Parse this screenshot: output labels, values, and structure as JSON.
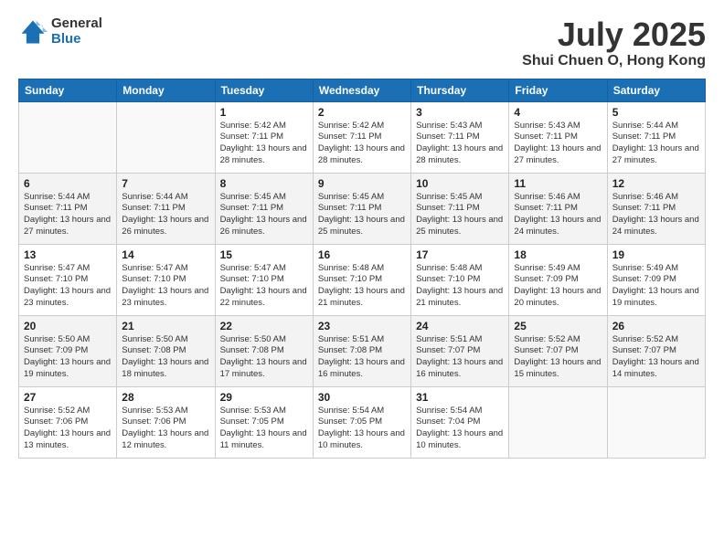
{
  "logo": {
    "general": "General",
    "blue": "Blue"
  },
  "title": "July 2025",
  "subtitle": "Shui Chuen O, Hong Kong",
  "headers": [
    "Sunday",
    "Monday",
    "Tuesday",
    "Wednesday",
    "Thursday",
    "Friday",
    "Saturday"
  ],
  "weeks": [
    [
      {
        "day": "",
        "sunrise": "",
        "sunset": "",
        "daylight": ""
      },
      {
        "day": "",
        "sunrise": "",
        "sunset": "",
        "daylight": ""
      },
      {
        "day": "1",
        "sunrise": "Sunrise: 5:42 AM",
        "sunset": "Sunset: 7:11 PM",
        "daylight": "Daylight: 13 hours and 28 minutes."
      },
      {
        "day": "2",
        "sunrise": "Sunrise: 5:42 AM",
        "sunset": "Sunset: 7:11 PM",
        "daylight": "Daylight: 13 hours and 28 minutes."
      },
      {
        "day": "3",
        "sunrise": "Sunrise: 5:43 AM",
        "sunset": "Sunset: 7:11 PM",
        "daylight": "Daylight: 13 hours and 28 minutes."
      },
      {
        "day": "4",
        "sunrise": "Sunrise: 5:43 AM",
        "sunset": "Sunset: 7:11 PM",
        "daylight": "Daylight: 13 hours and 27 minutes."
      },
      {
        "day": "5",
        "sunrise": "Sunrise: 5:44 AM",
        "sunset": "Sunset: 7:11 PM",
        "daylight": "Daylight: 13 hours and 27 minutes."
      }
    ],
    [
      {
        "day": "6",
        "sunrise": "Sunrise: 5:44 AM",
        "sunset": "Sunset: 7:11 PM",
        "daylight": "Daylight: 13 hours and 27 minutes."
      },
      {
        "day": "7",
        "sunrise": "Sunrise: 5:44 AM",
        "sunset": "Sunset: 7:11 PM",
        "daylight": "Daylight: 13 hours and 26 minutes."
      },
      {
        "day": "8",
        "sunrise": "Sunrise: 5:45 AM",
        "sunset": "Sunset: 7:11 PM",
        "daylight": "Daylight: 13 hours and 26 minutes."
      },
      {
        "day": "9",
        "sunrise": "Sunrise: 5:45 AM",
        "sunset": "Sunset: 7:11 PM",
        "daylight": "Daylight: 13 hours and 25 minutes."
      },
      {
        "day": "10",
        "sunrise": "Sunrise: 5:45 AM",
        "sunset": "Sunset: 7:11 PM",
        "daylight": "Daylight: 13 hours and 25 minutes."
      },
      {
        "day": "11",
        "sunrise": "Sunrise: 5:46 AM",
        "sunset": "Sunset: 7:11 PM",
        "daylight": "Daylight: 13 hours and 24 minutes."
      },
      {
        "day": "12",
        "sunrise": "Sunrise: 5:46 AM",
        "sunset": "Sunset: 7:11 PM",
        "daylight": "Daylight: 13 hours and 24 minutes."
      }
    ],
    [
      {
        "day": "13",
        "sunrise": "Sunrise: 5:47 AM",
        "sunset": "Sunset: 7:10 PM",
        "daylight": "Daylight: 13 hours and 23 minutes."
      },
      {
        "day": "14",
        "sunrise": "Sunrise: 5:47 AM",
        "sunset": "Sunset: 7:10 PM",
        "daylight": "Daylight: 13 hours and 23 minutes."
      },
      {
        "day": "15",
        "sunrise": "Sunrise: 5:47 AM",
        "sunset": "Sunset: 7:10 PM",
        "daylight": "Daylight: 13 hours and 22 minutes."
      },
      {
        "day": "16",
        "sunrise": "Sunrise: 5:48 AM",
        "sunset": "Sunset: 7:10 PM",
        "daylight": "Daylight: 13 hours and 21 minutes."
      },
      {
        "day": "17",
        "sunrise": "Sunrise: 5:48 AM",
        "sunset": "Sunset: 7:10 PM",
        "daylight": "Daylight: 13 hours and 21 minutes."
      },
      {
        "day": "18",
        "sunrise": "Sunrise: 5:49 AM",
        "sunset": "Sunset: 7:09 PM",
        "daylight": "Daylight: 13 hours and 20 minutes."
      },
      {
        "day": "19",
        "sunrise": "Sunrise: 5:49 AM",
        "sunset": "Sunset: 7:09 PM",
        "daylight": "Daylight: 13 hours and 19 minutes."
      }
    ],
    [
      {
        "day": "20",
        "sunrise": "Sunrise: 5:50 AM",
        "sunset": "Sunset: 7:09 PM",
        "daylight": "Daylight: 13 hours and 19 minutes."
      },
      {
        "day": "21",
        "sunrise": "Sunrise: 5:50 AM",
        "sunset": "Sunset: 7:08 PM",
        "daylight": "Daylight: 13 hours and 18 minutes."
      },
      {
        "day": "22",
        "sunrise": "Sunrise: 5:50 AM",
        "sunset": "Sunset: 7:08 PM",
        "daylight": "Daylight: 13 hours and 17 minutes."
      },
      {
        "day": "23",
        "sunrise": "Sunrise: 5:51 AM",
        "sunset": "Sunset: 7:08 PM",
        "daylight": "Daylight: 13 hours and 16 minutes."
      },
      {
        "day": "24",
        "sunrise": "Sunrise: 5:51 AM",
        "sunset": "Sunset: 7:07 PM",
        "daylight": "Daylight: 13 hours and 16 minutes."
      },
      {
        "day": "25",
        "sunrise": "Sunrise: 5:52 AM",
        "sunset": "Sunset: 7:07 PM",
        "daylight": "Daylight: 13 hours and 15 minutes."
      },
      {
        "day": "26",
        "sunrise": "Sunrise: 5:52 AM",
        "sunset": "Sunset: 7:07 PM",
        "daylight": "Daylight: 13 hours and 14 minutes."
      }
    ],
    [
      {
        "day": "27",
        "sunrise": "Sunrise: 5:52 AM",
        "sunset": "Sunset: 7:06 PM",
        "daylight": "Daylight: 13 hours and 13 minutes."
      },
      {
        "day": "28",
        "sunrise": "Sunrise: 5:53 AM",
        "sunset": "Sunset: 7:06 PM",
        "daylight": "Daylight: 13 hours and 12 minutes."
      },
      {
        "day": "29",
        "sunrise": "Sunrise: 5:53 AM",
        "sunset": "Sunset: 7:05 PM",
        "daylight": "Daylight: 13 hours and 11 minutes."
      },
      {
        "day": "30",
        "sunrise": "Sunrise: 5:54 AM",
        "sunset": "Sunset: 7:05 PM",
        "daylight": "Daylight: 13 hours and 10 minutes."
      },
      {
        "day": "31",
        "sunrise": "Sunrise: 5:54 AM",
        "sunset": "Sunset: 7:04 PM",
        "daylight": "Daylight: 13 hours and 10 minutes."
      },
      {
        "day": "",
        "sunrise": "",
        "sunset": "",
        "daylight": ""
      },
      {
        "day": "",
        "sunrise": "",
        "sunset": "",
        "daylight": ""
      }
    ]
  ]
}
